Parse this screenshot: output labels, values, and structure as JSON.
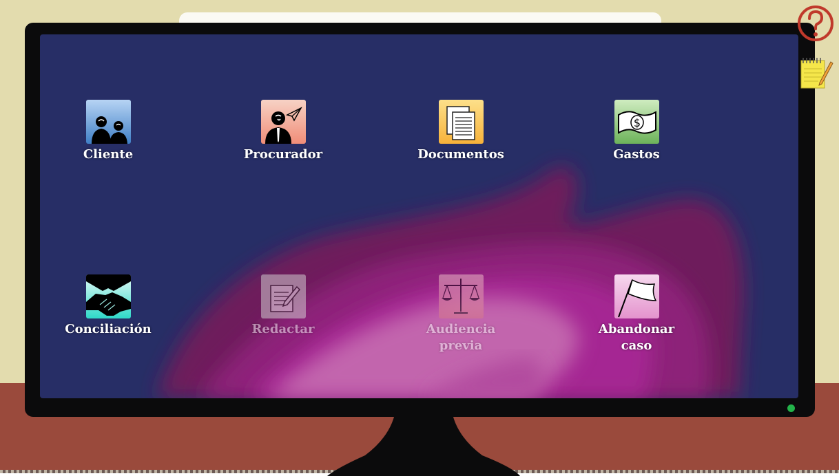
{
  "apps": [
    {
      "label": "Cliente",
      "icon": "clients-icon"
    },
    {
      "label": "Procurador",
      "icon": "attorney-icon"
    },
    {
      "label": "Documentos",
      "icon": "documents-icon"
    },
    {
      "label": "Gastos",
      "icon": "money-icon"
    },
    {
      "label": "Conciliación",
      "icon": "handshake-icon"
    },
    {
      "label": "Redactar",
      "icon": "write-icon"
    },
    {
      "label": "Audiencia\nprevia",
      "icon": "scales-icon"
    },
    {
      "label": "Abandonar\ncaso",
      "icon": "white-flag-icon"
    }
  ],
  "toolbar": {
    "help_icon": "question-mark-icon",
    "notes_icon": "notepad-icon"
  },
  "colors": {
    "screen": "#272e66",
    "wall": "#e3dcae",
    "desk": "#9a4a3c",
    "help": "#c0392b",
    "power_led": "#23b34a"
  }
}
